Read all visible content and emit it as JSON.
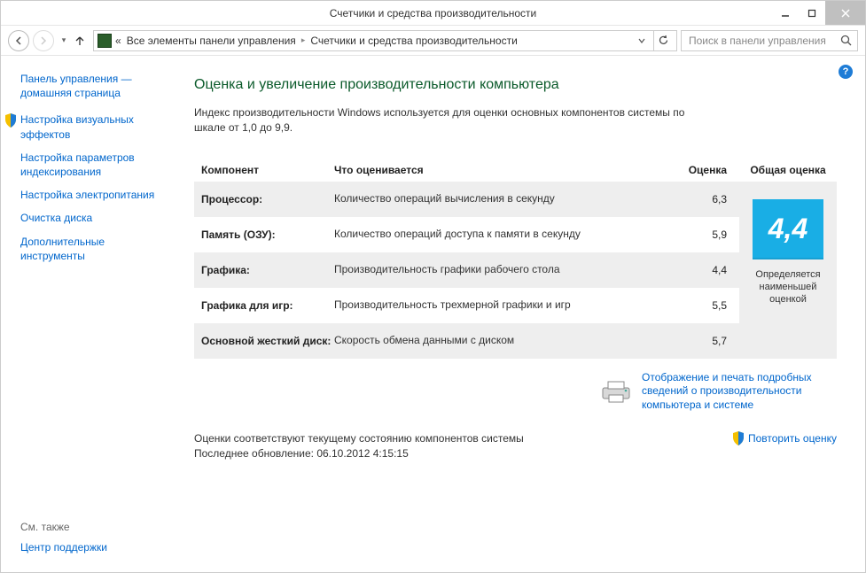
{
  "window": {
    "title": "Счетчики и средства производительности"
  },
  "nav": {
    "breadcrumb_prefix": "«",
    "breadcrumb_1": "Все элементы панели управления",
    "breadcrumb_2": "Счетчики и средства производительности",
    "search_placeholder": "Поиск в панели управления"
  },
  "sidebar": {
    "home_line1": "Панель управления —",
    "home_line2": "домашняя страница",
    "items": [
      {
        "label": "Настройка визуальных эффектов",
        "shield": true
      },
      {
        "label": "Настройка параметров индексирования",
        "shield": false
      },
      {
        "label": "Настройка электропитания",
        "shield": false
      },
      {
        "label": "Очистка диска",
        "shield": false
      },
      {
        "label": "Дополнительные инструменты",
        "shield": false
      }
    ],
    "see_also_header": "См. также",
    "see_also_link": "Центр поддержки"
  },
  "main": {
    "title": "Оценка и увеличение производительности компьютера",
    "description": "Индекс производительности Windows используется для оценки основных компонентов системы по шкале от 1,0 до 9,9.",
    "col_component": "Компонент",
    "col_what": "Что оценивается",
    "col_score": "Оценка",
    "col_base": "Общая оценка",
    "rows": [
      {
        "comp": "Процессор:",
        "desc": "Количество операций вычисления в секунду",
        "score": "6,3"
      },
      {
        "comp": "Память (ОЗУ):",
        "desc": "Количество операций доступа к памяти в секунду",
        "score": "5,9"
      },
      {
        "comp": "Графика:",
        "desc": "Производительность графики рабочего стола",
        "score": "4,4"
      },
      {
        "comp": "Графика для игр:",
        "desc": "Производительность трехмерной графики и игр",
        "score": "5,5"
      },
      {
        "comp": "Основной жесткий диск:",
        "desc": "Скорость обмена данными с диском",
        "score": "5,7"
      }
    ],
    "base_score": "4,4",
    "base_caption": "Определяется наименьшей оценкой",
    "print_link": "Отображение и печать подробных сведений о производительности компьютера и системе",
    "status_line1": "Оценки соответствуют текущему состоянию компонентов системы",
    "status_line2": "Последнее обновление: 06.10.2012 4:15:15",
    "rerun_label": "Повторить оценку"
  }
}
